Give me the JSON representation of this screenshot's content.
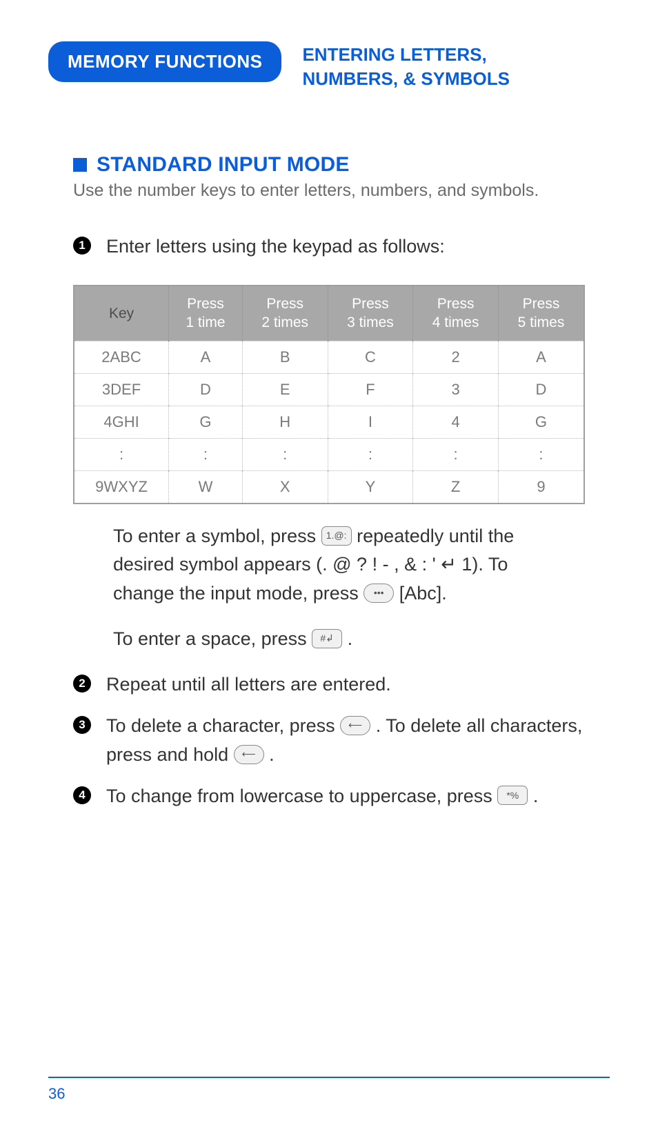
{
  "header": {
    "tab": "MEMORY FUNCTIONS",
    "title_line1": "ENTERING LETTERS,",
    "title_line2": "NUMBERS, & SYMBOLS"
  },
  "section": {
    "heading": "STANDARD INPUT MODE",
    "subtext": "Use the number keys to enter letters, numbers, and symbols."
  },
  "steps": {
    "s1": "Enter letters using the keypad as follows:",
    "s2": "Repeat until all letters are entered.",
    "s3a": "To delete a character, press ",
    "s3b": " . To delete all characters, press and hold ",
    "s3c": " .",
    "s4a": "To change from lowercase to uppercase, press ",
    "s4b": " ."
  },
  "chart_data": {
    "type": "table",
    "title": "",
    "columns": [
      "Key",
      "Press\n1 time",
      "Press\n2 times",
      "Press\n3 times",
      "Press\n4 times",
      "Press\n5 times"
    ],
    "rows": [
      [
        "2ABC",
        "A",
        "B",
        "C",
        "2",
        "A"
      ],
      [
        "3DEF",
        "D",
        "E",
        "F",
        "3",
        "D"
      ],
      [
        "4GHI",
        "G",
        "H",
        "I",
        "4",
        "G"
      ],
      [
        ":",
        ":",
        ":",
        ":",
        ":",
        ":"
      ],
      [
        "9WXYZ",
        "W",
        "X",
        "Y",
        "Z",
        "9"
      ]
    ]
  },
  "para": {
    "p1a": "To enter a symbol, press ",
    "p1b": " repeatedly until the desired symbol appears (. @ ? ! - , & : ' ↵ 1). To change the input mode, press ",
    "p1c": " [Abc].",
    "p2a": "To enter a space, press ",
    "p2b": " ."
  },
  "icons": {
    "one_key": "1.@:",
    "soft_key": "•••",
    "hash_key": "#↲",
    "back_key": "⟵",
    "star_key": "*%"
  },
  "footer": {
    "page": "36"
  }
}
